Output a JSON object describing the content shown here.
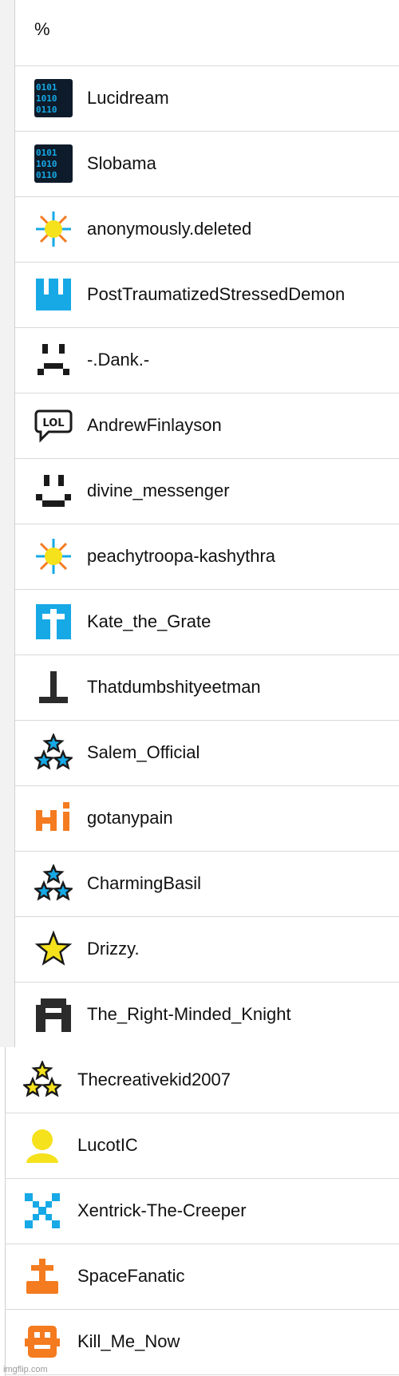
{
  "header": {
    "label": "%"
  },
  "users_top": [
    {
      "name": "Lucidream",
      "icon": "binary-icon"
    },
    {
      "name": "Slobama",
      "icon": "binary-icon"
    },
    {
      "name": "anonymously.deleted",
      "icon": "sun-icon"
    },
    {
      "name": "PostTraumatizedStressedDemon",
      "icon": "castle-icon"
    },
    {
      "name": "-.Dank.-",
      "icon": "sad-face-icon"
    },
    {
      "name": "AndrewFinlayson",
      "icon": "lol-bubble-icon"
    },
    {
      "name": "divine_messenger",
      "icon": "smiley-face-icon"
    },
    {
      "name": "peachytroopa-kashythra",
      "icon": "sun-icon"
    },
    {
      "name": "Kate_the_Grate",
      "icon": "cross-icon"
    },
    {
      "name": "Thatdumbshityeetman",
      "icon": "t-shape-icon"
    },
    {
      "name": "Salem_Official",
      "icon": "three-stars-blue-icon"
    },
    {
      "name": "gotanypain",
      "icon": "hi-icon"
    },
    {
      "name": "CharmingBasil",
      "icon": "three-stars-blue-icon"
    },
    {
      "name": "Drizzy.",
      "icon": "star-icon"
    },
    {
      "name": "The_Right-Minded_Knight",
      "icon": "knight-helmet-icon"
    }
  ],
  "users_bottom": [
    {
      "name": "Thecreativekid2007",
      "icon": "three-stars-yellow-icon"
    },
    {
      "name": "LucotIC",
      "icon": "user-silhouette-icon"
    },
    {
      "name": "Xentrick-The-Creeper",
      "icon": "x-pixel-icon"
    },
    {
      "name": "SpaceFanatic",
      "icon": "orange-cross-icon"
    },
    {
      "name": "Kill_Me_Now",
      "icon": "robot-face-icon"
    }
  ],
  "watermark": "imgflip.com",
  "colors": {
    "blue": "#16a9e6",
    "orange": "#f47b20",
    "yellow": "#f5e11c",
    "black": "#1a1a1a"
  }
}
